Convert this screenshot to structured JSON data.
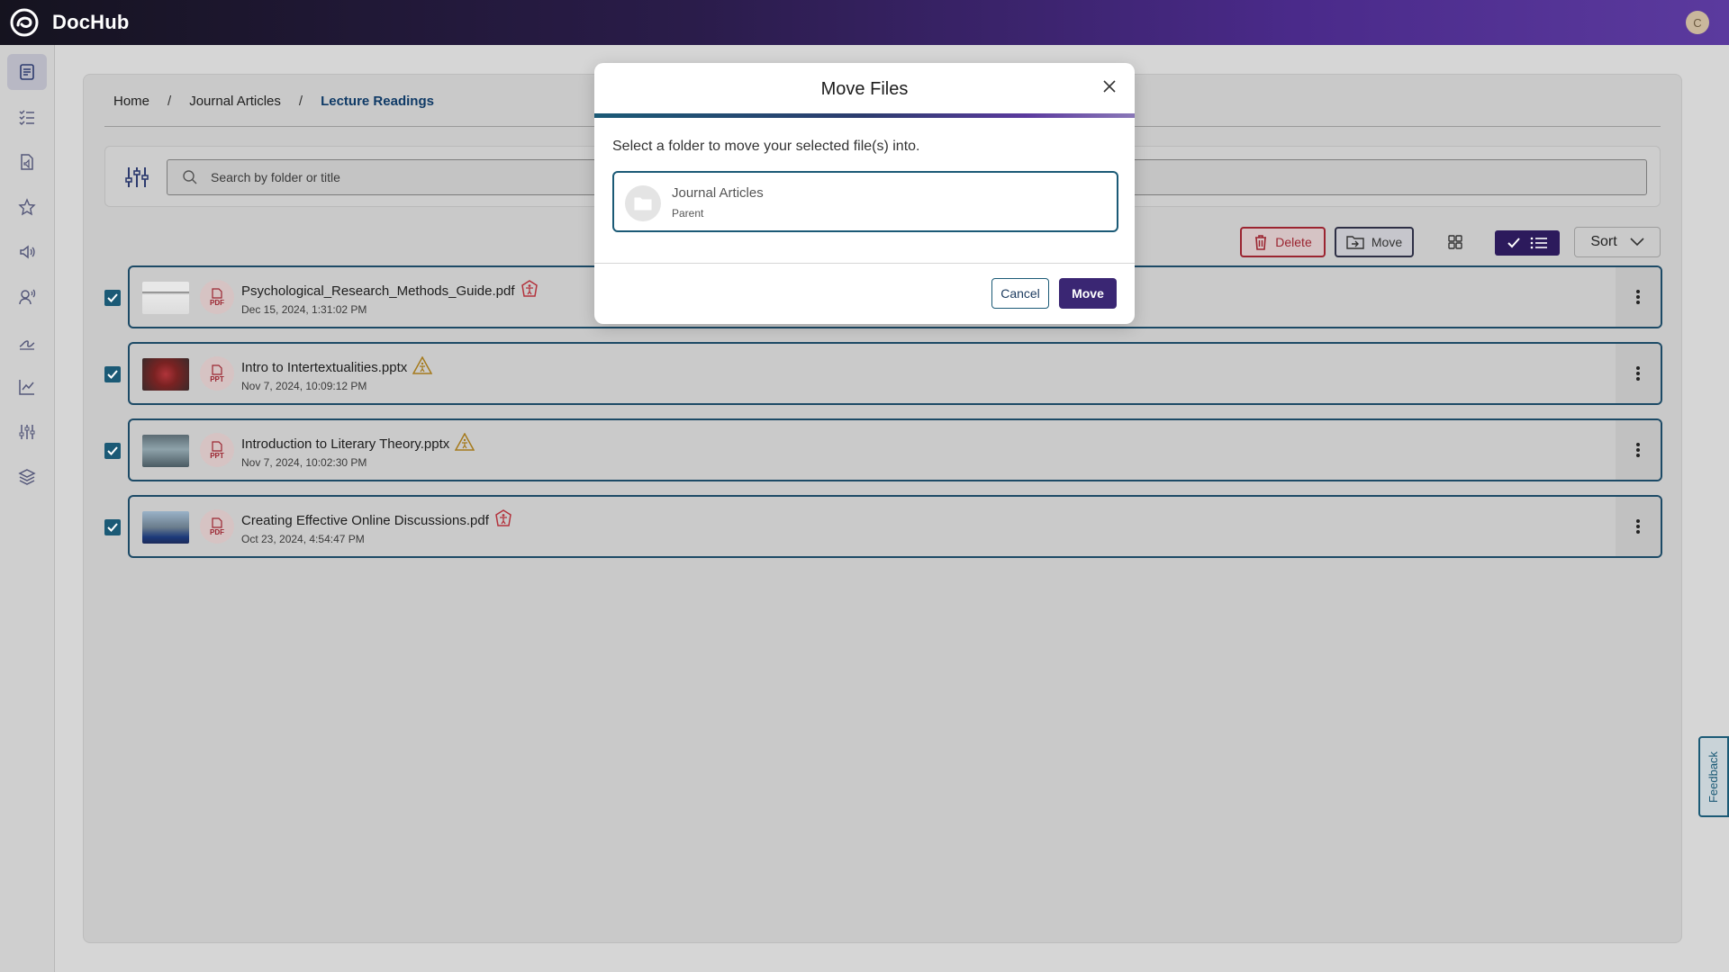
{
  "app": {
    "name": "DocHub",
    "avatar_initial": "C"
  },
  "sidebar": {
    "items": [
      {
        "icon": "document-icon",
        "active": true
      },
      {
        "icon": "checklist-icon"
      },
      {
        "icon": "audio-file-icon"
      },
      {
        "icon": "accessibility-icon"
      },
      {
        "icon": "speaker-icon"
      },
      {
        "icon": "voice-user-icon"
      },
      {
        "icon": "sign-icon"
      },
      {
        "icon": "chart-icon"
      },
      {
        "icon": "sliders-icon"
      },
      {
        "icon": "layers-icon"
      }
    ]
  },
  "breadcrumb": {
    "home": "Home",
    "parent": "Journal Articles",
    "current": "Lecture Readings",
    "separator": "/"
  },
  "search": {
    "placeholder": "Search by folder or title"
  },
  "toolbar": {
    "delete_label": "Delete",
    "move_label": "Move",
    "sort_label": "Sort"
  },
  "files": [
    {
      "name": "Psychological_Research_Methods_Guide.pdf",
      "date": "Dec 15, 2024, 1:31:02 PM",
      "type": "PDF",
      "badge": "accessibility-error-icon",
      "checked": true
    },
    {
      "name": "Intro to Intertextualities.pptx",
      "date": "Nov 7, 2024, 10:09:12 PM",
      "type": "PPT",
      "badge": "warning-icon",
      "checked": true
    },
    {
      "name": "Introduction to Literary Theory.pptx",
      "date": "Nov 7, 2024, 10:02:30 PM",
      "type": "PPT",
      "badge": "warning-icon",
      "checked": true
    },
    {
      "name": "Creating Effective Online Discussions.pdf",
      "date": "Oct 23, 2024, 4:54:47 PM",
      "type": "PDF",
      "badge": "accessibility-error-icon",
      "checked": true
    }
  ],
  "feedback": {
    "label": "Feedback"
  },
  "modal": {
    "title": "Move Files",
    "description": "Select a folder to move your selected file(s) into.",
    "folder": {
      "name": "Journal Articles",
      "sub": "Parent"
    },
    "cancel_label": "Cancel",
    "confirm_label": "Move"
  },
  "colors": {
    "accent": "#1b5a76",
    "brand": "#3a2673",
    "danger": "#9b2430"
  }
}
